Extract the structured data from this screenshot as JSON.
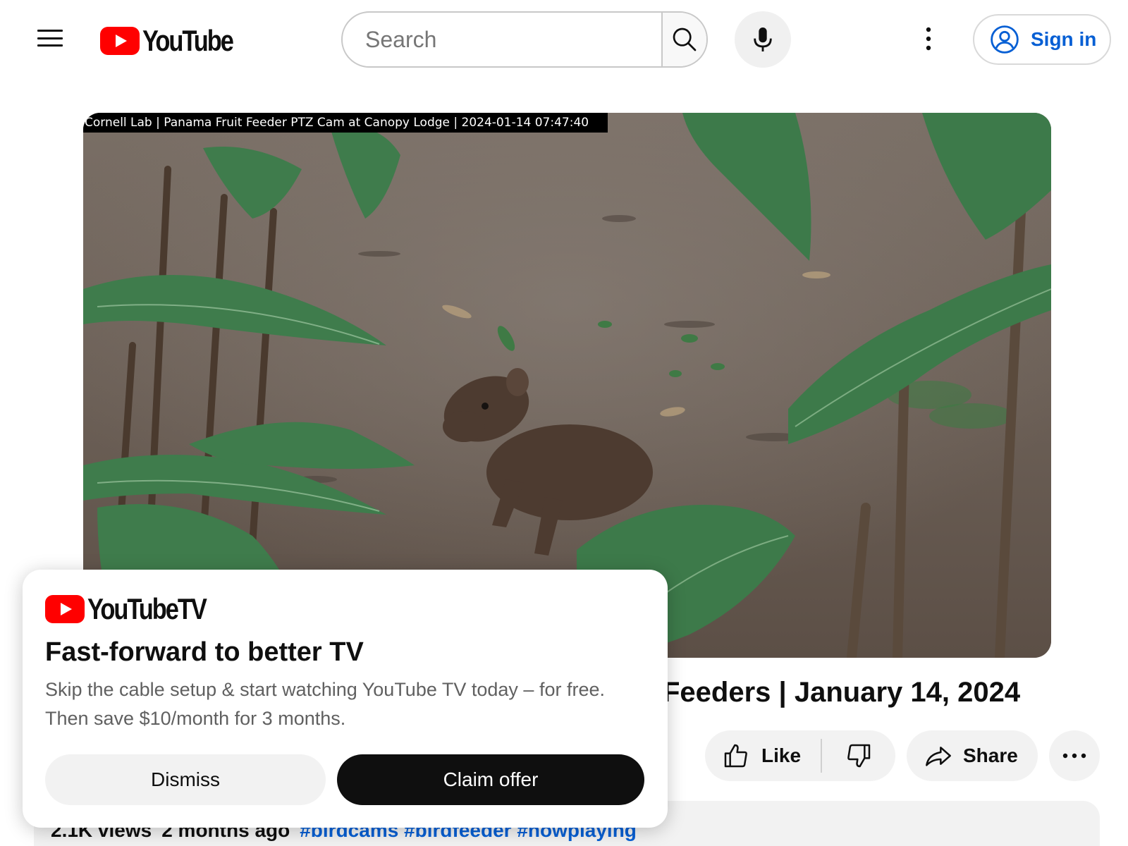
{
  "header": {
    "logo_text": "YouTube",
    "search": {
      "placeholder": "Search",
      "value": ""
    },
    "sign_in_label": "Sign in",
    "icons": [
      "menu-icon",
      "search-icon",
      "microphone-icon",
      "more-vertical-icon",
      "account-icon"
    ]
  },
  "player": {
    "overlay_text": "Cornell Lab | Panama Fruit Feeder PTZ Cam at Canopy Lodge | 2024-01-14  07:47:40"
  },
  "video": {
    "title_visible": "Feeders | January 14, 2024",
    "actions": {
      "like_label": "Like",
      "share_label": "Share"
    },
    "description": {
      "views": "2.1K views",
      "age": "2 months ago",
      "hashtags": "#birdcams #birdfeeder #nowplaying"
    }
  },
  "promo": {
    "logo_text": "YouTubeTV",
    "title": "Fast-forward to better TV",
    "body": "Skip the cable setup & start watching YouTube TV today – for free. Then save $10/month for 3 months.",
    "dismiss_label": "Dismiss",
    "claim_label": "Claim offer"
  },
  "colors": {
    "brand_red": "#ff0000",
    "link_blue": "#065fd4",
    "button_gray": "#f2f2f2",
    "primary_dark": "#0f0f0f"
  }
}
